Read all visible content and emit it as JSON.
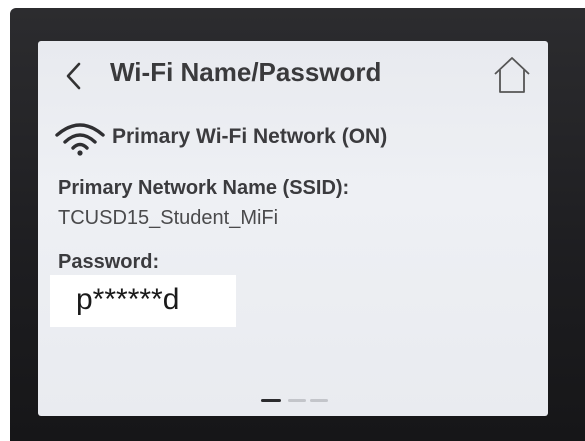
{
  "header": {
    "back_glyph": "<",
    "title": "Wi-Fi Name/Password"
  },
  "network": {
    "section_title": "Primary Wi-Fi Network (ON)",
    "ssid_label": "Primary Network Name (SSID):",
    "ssid_value": "TCUSD15_Student_MiFi",
    "password_label": "Password:",
    "password_value": "p******d"
  },
  "pager": {
    "page_count": 3,
    "active_page": 1
  },
  "icons": {
    "back": "chevron-left-icon",
    "home": "home-icon",
    "wifi": "wifi-icon"
  },
  "colors": {
    "screen_bg": "#eceef2",
    "bezel": "#222225",
    "text": "#3b3b3e"
  }
}
